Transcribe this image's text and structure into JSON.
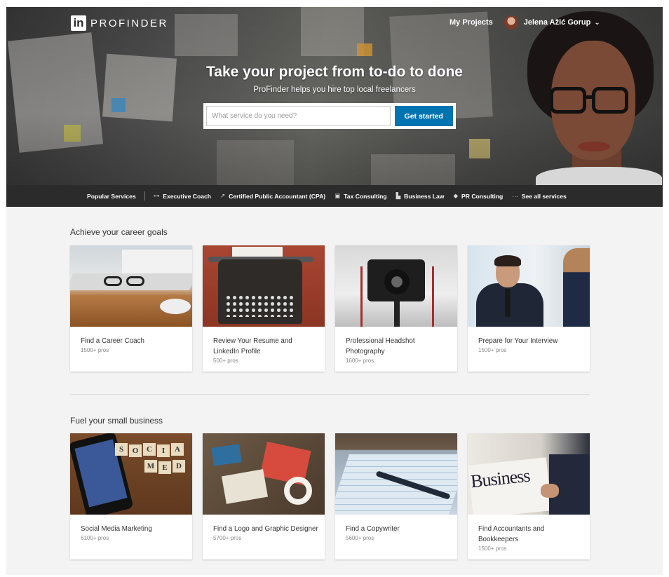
{
  "header": {
    "logo_in": "in",
    "logo_word": "PROFINDER",
    "my_projects": "My Projects",
    "user_name": "Jelena Ažić Gorup",
    "chevron": "⌄"
  },
  "hero": {
    "title": "Take your project from to-do to done",
    "subtitle": "ProFinder helps you hire top local freelancers",
    "search_placeholder": "What service do you need?",
    "cta": "Get started"
  },
  "services_bar": {
    "label": "Popular Services",
    "items": [
      {
        "icon": "key-icon",
        "glyph": "⊶",
        "label": "Executive Coach"
      },
      {
        "icon": "chart-icon",
        "glyph": "↗",
        "label": "Certified Public Accountant (CPA)"
      },
      {
        "icon": "receipt-icon",
        "glyph": "▣",
        "label": "Tax Consulting"
      },
      {
        "icon": "briefcase-icon",
        "glyph": "▙",
        "label": "Business Law"
      },
      {
        "icon": "tag-icon",
        "glyph": "◆",
        "label": "PR Consulting"
      },
      {
        "icon": "more-icon",
        "glyph": "···",
        "label": "See all services"
      }
    ]
  },
  "sections": [
    {
      "title": "Achieve your career goals",
      "cards": [
        {
          "title": "Find a Career Coach",
          "count": "1500+ pros"
        },
        {
          "title": "Review Your Resume and LinkedIn Profile",
          "count": "500+ pros"
        },
        {
          "title": "Professional Headshot Photography",
          "count": "1600+ pros"
        },
        {
          "title": "Prepare for Your Interview",
          "count": "1500+ pros"
        }
      ]
    },
    {
      "title": "Fuel your small business",
      "cards": [
        {
          "title": "Social Media Marketing",
          "count": "6100+ pros"
        },
        {
          "title": "Find a Logo and Graphic Designer",
          "count": "5700+ pros"
        },
        {
          "title": "Find a Copywriter",
          "count": "5600+ pros"
        },
        {
          "title": "Find Accountants and Bookkeepers",
          "count": "1500+ pros"
        }
      ]
    }
  ],
  "image_text": {
    "social_tiles": [
      "S",
      "O",
      "C",
      "I",
      "A",
      "M",
      "E",
      "D"
    ],
    "business_word": "Business"
  },
  "colors": {
    "accent": "#0073b1",
    "services_bar_bg": "#2b2b2b",
    "page_bg": "#f3f3f3"
  }
}
